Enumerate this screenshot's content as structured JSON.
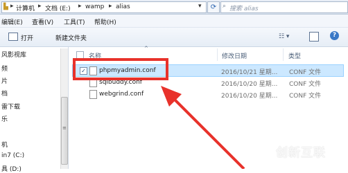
{
  "address_bar": {
    "crumbs": [
      "计算机",
      "文档 (E:)",
      "wamp",
      "alias"
    ],
    "search_placeholder": "搜索 alias"
  },
  "menu": [
    "编辑(E)",
    "查看(V)",
    "工具(T)",
    "帮助(H)"
  ],
  "toolbar": {
    "open_label": "打开",
    "new_folder_label": "新建文件夹"
  },
  "nav_items": [
    "风影视库",
    "频",
    "片",
    "档",
    "雷下载",
    "乐",
    "机",
    "in7 (C:)",
    "具 (D:)"
  ],
  "columns": {
    "name": "名称",
    "date": "修改日期",
    "type": "类型"
  },
  "files": [
    {
      "name": "phpmyadmin.conf",
      "date": "2016/10/21 星期...",
      "type": "CONF 文件",
      "selected": true
    },
    {
      "name": "sqlbuddy.conf",
      "date": "2016/10/20 星期...",
      "type": "CONF 文件",
      "selected": false
    },
    {
      "name": "webgrind.conf",
      "date": "2016/10/20 星期...",
      "type": "CONF 文件",
      "selected": false
    }
  ],
  "watermark": {
    "text": "创新互联"
  },
  "colors": {
    "annotation": "#e8322b",
    "selection": "#cce8ff"
  }
}
